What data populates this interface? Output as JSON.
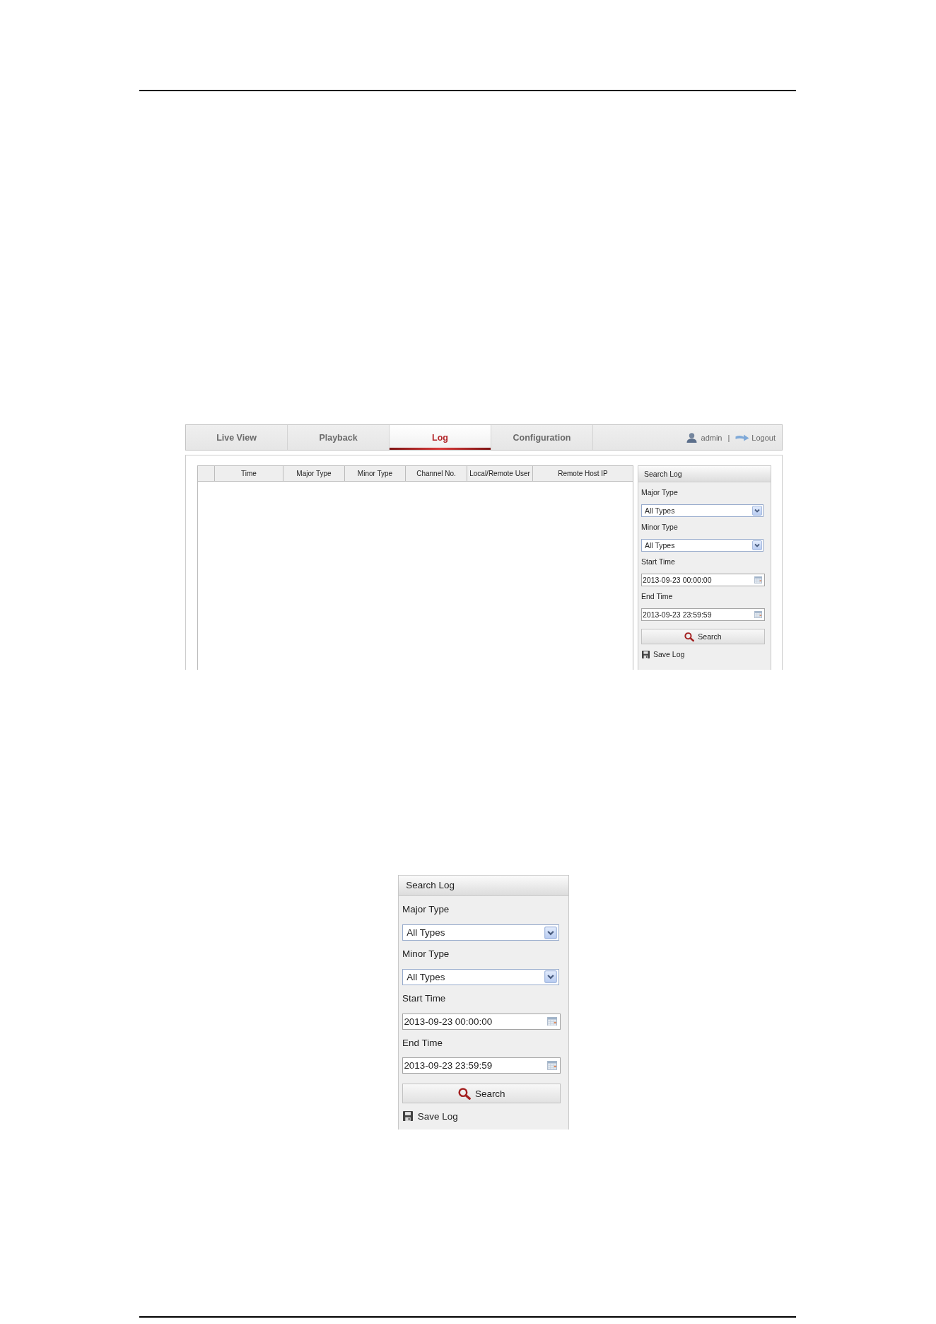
{
  "app_screenshot": {
    "tabs": [
      {
        "label": "Live View",
        "selected": false
      },
      {
        "label": "Playback",
        "selected": false
      },
      {
        "label": "Log",
        "selected": true
      },
      {
        "label": "Configuration",
        "selected": false
      }
    ],
    "user": {
      "name": "admin",
      "separator": "|",
      "logout": "Logout"
    },
    "log_table": {
      "columns": [
        "Time",
        "Major Type",
        "Minor Type",
        "Channel No.",
        "Local/Remote User",
        "Remote Host IP"
      ]
    },
    "search_panel": {
      "title": "Search Log",
      "fields": [
        {
          "label": "Major Type",
          "kind": "select",
          "value": "All Types"
        },
        {
          "label": "Minor Type",
          "kind": "select",
          "value": "All Types"
        },
        {
          "label": "Start Time",
          "kind": "datetime",
          "value": "2013-09-23 00:00:00"
        },
        {
          "label": "End Time",
          "kind": "datetime",
          "value": "2013-09-23 23:59:59"
        }
      ],
      "search_button": "Search",
      "save_link": "Save Log"
    }
  },
  "search_panel_closeup": {
    "title": "Search Log",
    "fields": [
      {
        "label": "Major Type",
        "kind": "select",
        "value": "All Types"
      },
      {
        "label": "Minor Type",
        "kind": "select",
        "value": "All Types"
      },
      {
        "label": "Start Time",
        "kind": "datetime",
        "value": "2013-09-23 00:00:00"
      },
      {
        "label": "End Time",
        "kind": "datetime",
        "value": "2013-09-23 23:59:59"
      }
    ],
    "search_button": "Search",
    "save_link": "Save Log"
  }
}
